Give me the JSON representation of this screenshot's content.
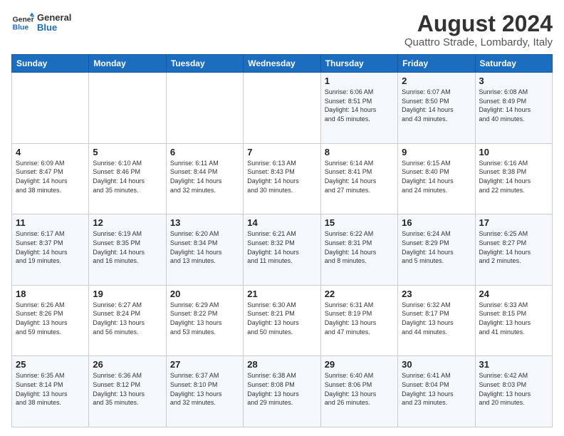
{
  "header": {
    "logo_line1": "General",
    "logo_line2": "Blue",
    "main_title": "August 2024",
    "subtitle": "Quattro Strade, Lombardy, Italy"
  },
  "columns": [
    "Sunday",
    "Monday",
    "Tuesday",
    "Wednesday",
    "Thursday",
    "Friday",
    "Saturday"
  ],
  "weeks": [
    [
      {
        "num": "",
        "detail": ""
      },
      {
        "num": "",
        "detail": ""
      },
      {
        "num": "",
        "detail": ""
      },
      {
        "num": "",
        "detail": ""
      },
      {
        "num": "1",
        "detail": "Sunrise: 6:06 AM\nSunset: 8:51 PM\nDaylight: 14 hours\nand 45 minutes."
      },
      {
        "num": "2",
        "detail": "Sunrise: 6:07 AM\nSunset: 8:50 PM\nDaylight: 14 hours\nand 43 minutes."
      },
      {
        "num": "3",
        "detail": "Sunrise: 6:08 AM\nSunset: 8:49 PM\nDaylight: 14 hours\nand 40 minutes."
      }
    ],
    [
      {
        "num": "4",
        "detail": "Sunrise: 6:09 AM\nSunset: 8:47 PM\nDaylight: 14 hours\nand 38 minutes."
      },
      {
        "num": "5",
        "detail": "Sunrise: 6:10 AM\nSunset: 8:46 PM\nDaylight: 14 hours\nand 35 minutes."
      },
      {
        "num": "6",
        "detail": "Sunrise: 6:11 AM\nSunset: 8:44 PM\nDaylight: 14 hours\nand 32 minutes."
      },
      {
        "num": "7",
        "detail": "Sunrise: 6:13 AM\nSunset: 8:43 PM\nDaylight: 14 hours\nand 30 minutes."
      },
      {
        "num": "8",
        "detail": "Sunrise: 6:14 AM\nSunset: 8:41 PM\nDaylight: 14 hours\nand 27 minutes."
      },
      {
        "num": "9",
        "detail": "Sunrise: 6:15 AM\nSunset: 8:40 PM\nDaylight: 14 hours\nand 24 minutes."
      },
      {
        "num": "10",
        "detail": "Sunrise: 6:16 AM\nSunset: 8:38 PM\nDaylight: 14 hours\nand 22 minutes."
      }
    ],
    [
      {
        "num": "11",
        "detail": "Sunrise: 6:17 AM\nSunset: 8:37 PM\nDaylight: 14 hours\nand 19 minutes."
      },
      {
        "num": "12",
        "detail": "Sunrise: 6:19 AM\nSunset: 8:35 PM\nDaylight: 14 hours\nand 16 minutes."
      },
      {
        "num": "13",
        "detail": "Sunrise: 6:20 AM\nSunset: 8:34 PM\nDaylight: 14 hours\nand 13 minutes."
      },
      {
        "num": "14",
        "detail": "Sunrise: 6:21 AM\nSunset: 8:32 PM\nDaylight: 14 hours\nand 11 minutes."
      },
      {
        "num": "15",
        "detail": "Sunrise: 6:22 AM\nSunset: 8:31 PM\nDaylight: 14 hours\nand 8 minutes."
      },
      {
        "num": "16",
        "detail": "Sunrise: 6:24 AM\nSunset: 8:29 PM\nDaylight: 14 hours\nand 5 minutes."
      },
      {
        "num": "17",
        "detail": "Sunrise: 6:25 AM\nSunset: 8:27 PM\nDaylight: 14 hours\nand 2 minutes."
      }
    ],
    [
      {
        "num": "18",
        "detail": "Sunrise: 6:26 AM\nSunset: 8:26 PM\nDaylight: 13 hours\nand 59 minutes."
      },
      {
        "num": "19",
        "detail": "Sunrise: 6:27 AM\nSunset: 8:24 PM\nDaylight: 13 hours\nand 56 minutes."
      },
      {
        "num": "20",
        "detail": "Sunrise: 6:29 AM\nSunset: 8:22 PM\nDaylight: 13 hours\nand 53 minutes."
      },
      {
        "num": "21",
        "detail": "Sunrise: 6:30 AM\nSunset: 8:21 PM\nDaylight: 13 hours\nand 50 minutes."
      },
      {
        "num": "22",
        "detail": "Sunrise: 6:31 AM\nSunset: 8:19 PM\nDaylight: 13 hours\nand 47 minutes."
      },
      {
        "num": "23",
        "detail": "Sunrise: 6:32 AM\nSunset: 8:17 PM\nDaylight: 13 hours\nand 44 minutes."
      },
      {
        "num": "24",
        "detail": "Sunrise: 6:33 AM\nSunset: 8:15 PM\nDaylight: 13 hours\nand 41 minutes."
      }
    ],
    [
      {
        "num": "25",
        "detail": "Sunrise: 6:35 AM\nSunset: 8:14 PM\nDaylight: 13 hours\nand 38 minutes."
      },
      {
        "num": "26",
        "detail": "Sunrise: 6:36 AM\nSunset: 8:12 PM\nDaylight: 13 hours\nand 35 minutes."
      },
      {
        "num": "27",
        "detail": "Sunrise: 6:37 AM\nSunset: 8:10 PM\nDaylight: 13 hours\nand 32 minutes."
      },
      {
        "num": "28",
        "detail": "Sunrise: 6:38 AM\nSunset: 8:08 PM\nDaylight: 13 hours\nand 29 minutes."
      },
      {
        "num": "29",
        "detail": "Sunrise: 6:40 AM\nSunset: 8:06 PM\nDaylight: 13 hours\nand 26 minutes."
      },
      {
        "num": "30",
        "detail": "Sunrise: 6:41 AM\nSunset: 8:04 PM\nDaylight: 13 hours\nand 23 minutes."
      },
      {
        "num": "31",
        "detail": "Sunrise: 6:42 AM\nSunset: 8:03 PM\nDaylight: 13 hours\nand 20 minutes."
      }
    ]
  ]
}
